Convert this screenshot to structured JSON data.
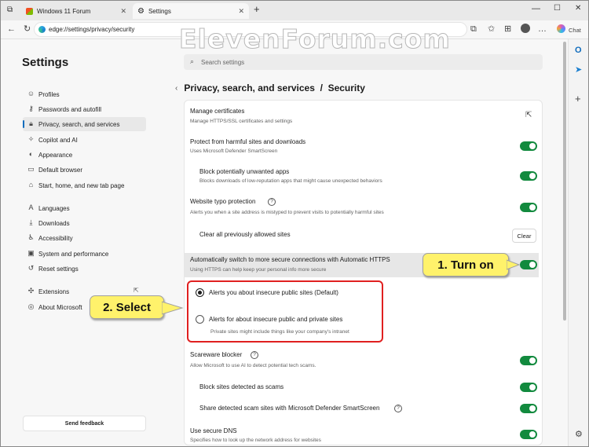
{
  "browser": {
    "tabs": [
      {
        "label": "Windows 11 Forum"
      },
      {
        "label": "Settings"
      }
    ],
    "new_tab": "+",
    "address": "edge://settings/privacy/security",
    "chat_label": "Chat",
    "watermark": "ElevenForum.com"
  },
  "sidebar": {
    "title": "Settings",
    "items": [
      {
        "label": "Profiles",
        "icon": "profile-icon"
      },
      {
        "label": "Passwords and autofill",
        "icon": "key-icon"
      },
      {
        "label": "Privacy, search, and services",
        "icon": "lock-icon"
      },
      {
        "label": "Copilot and AI",
        "icon": "copilot-icon"
      },
      {
        "label": "Appearance",
        "icon": "appearance-icon"
      },
      {
        "label": "Default browser",
        "icon": "browser-icon"
      },
      {
        "label": "Start, home, and new tab page",
        "icon": "home-icon"
      },
      {
        "label": "Languages",
        "icon": "languages-icon"
      },
      {
        "label": "Downloads",
        "icon": "download-icon"
      },
      {
        "label": "Accessibility",
        "icon": "accessibility-icon"
      },
      {
        "label": "System and performance",
        "icon": "system-icon"
      },
      {
        "label": "Reset settings",
        "icon": "reset-icon"
      },
      {
        "label": "Extensions",
        "icon": "extensions-icon"
      },
      {
        "label": "About Microsoft",
        "icon": "edge-icon"
      }
    ],
    "feedback": "Send feedback"
  },
  "search": {
    "placeholder": "Search settings"
  },
  "main": {
    "breadcrumb": "Privacy, search, and services  /  Security",
    "rows": {
      "certs": {
        "title": "Manage certificates",
        "sub": "Manage HTTPS/SSL certificates and settings"
      },
      "smartscreen": {
        "title": "Protect from harmful sites and downloads",
        "sub": "Uses Microsoft Defender SmartScreen"
      },
      "pua": {
        "title": "Block potentially unwanted apps",
        "sub": "Blocks downloads of low-reputation apps that might cause unexpected behaviors"
      },
      "typo": {
        "title": "Website typo protection",
        "sub": "Alerts you when a site address is mistyped to prevent visits to potentially harmful sites"
      },
      "clear": {
        "title": "Clear all previously allowed sites",
        "button": "Clear"
      },
      "https": {
        "title": "Automatically switch to more secure connections with Automatic HTTPS",
        "sub": "Using HTTPS can help keep your personal info more secure"
      },
      "radio1": {
        "label": "Alerts you about insecure public sites (Default)"
      },
      "radio2": {
        "label": "Alerts for about insecure public and private sites",
        "sub": "Private sites might include things like your company's intranet"
      },
      "scareware": {
        "title": "Scareware blocker",
        "sub": "Allow Microsoft to use AI to detect potential tech scams."
      },
      "block_scams": {
        "title": "Block sites detected as scams"
      },
      "share_scams": {
        "title": "Share detected scam sites with Microsoft Defender SmartScreen"
      },
      "dns": {
        "title": "Use secure DNS",
        "sub": "Specifies how to look up the network address for websites"
      }
    }
  },
  "callouts": {
    "turn_on": "1. Turn on",
    "select": "2. Select"
  },
  "colors": {
    "toggle_on": "#128a3e",
    "callout": "#fff26b",
    "highlight_box": "#e02020",
    "accent": "#0f6cbd"
  }
}
